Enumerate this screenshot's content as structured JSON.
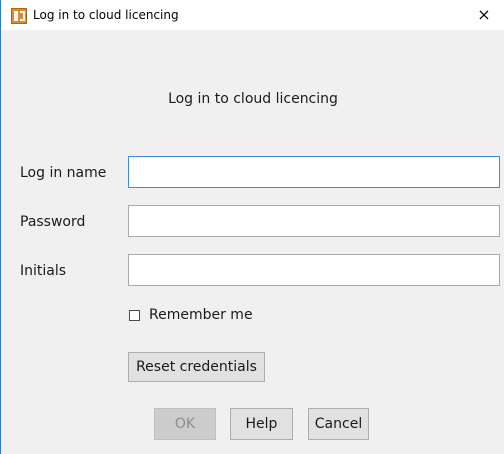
{
  "window": {
    "title": "Log in to cloud licencing",
    "close_glyph": "×",
    "app_icon": "application-icon"
  },
  "form": {
    "heading": "Log in to cloud licencing",
    "fields": [
      {
        "label": "Log in name",
        "value": "",
        "focused": true
      },
      {
        "label": "Password",
        "value": "",
        "focused": false
      },
      {
        "label": "Initials",
        "value": "",
        "focused": false
      }
    ],
    "remember_me": {
      "label": "Remember me",
      "checked": false
    },
    "reset_credentials_label": "Reset credentials"
  },
  "buttons": {
    "ok": {
      "label": "OK",
      "enabled": false
    },
    "help": {
      "label": "Help",
      "enabled": true
    },
    "cancel": {
      "label": "Cancel",
      "enabled": true
    }
  },
  "colors": {
    "focus_border": "#3c8fd8",
    "window_border": "#2b7bd0",
    "dialog_background": "#f0f0f0"
  }
}
